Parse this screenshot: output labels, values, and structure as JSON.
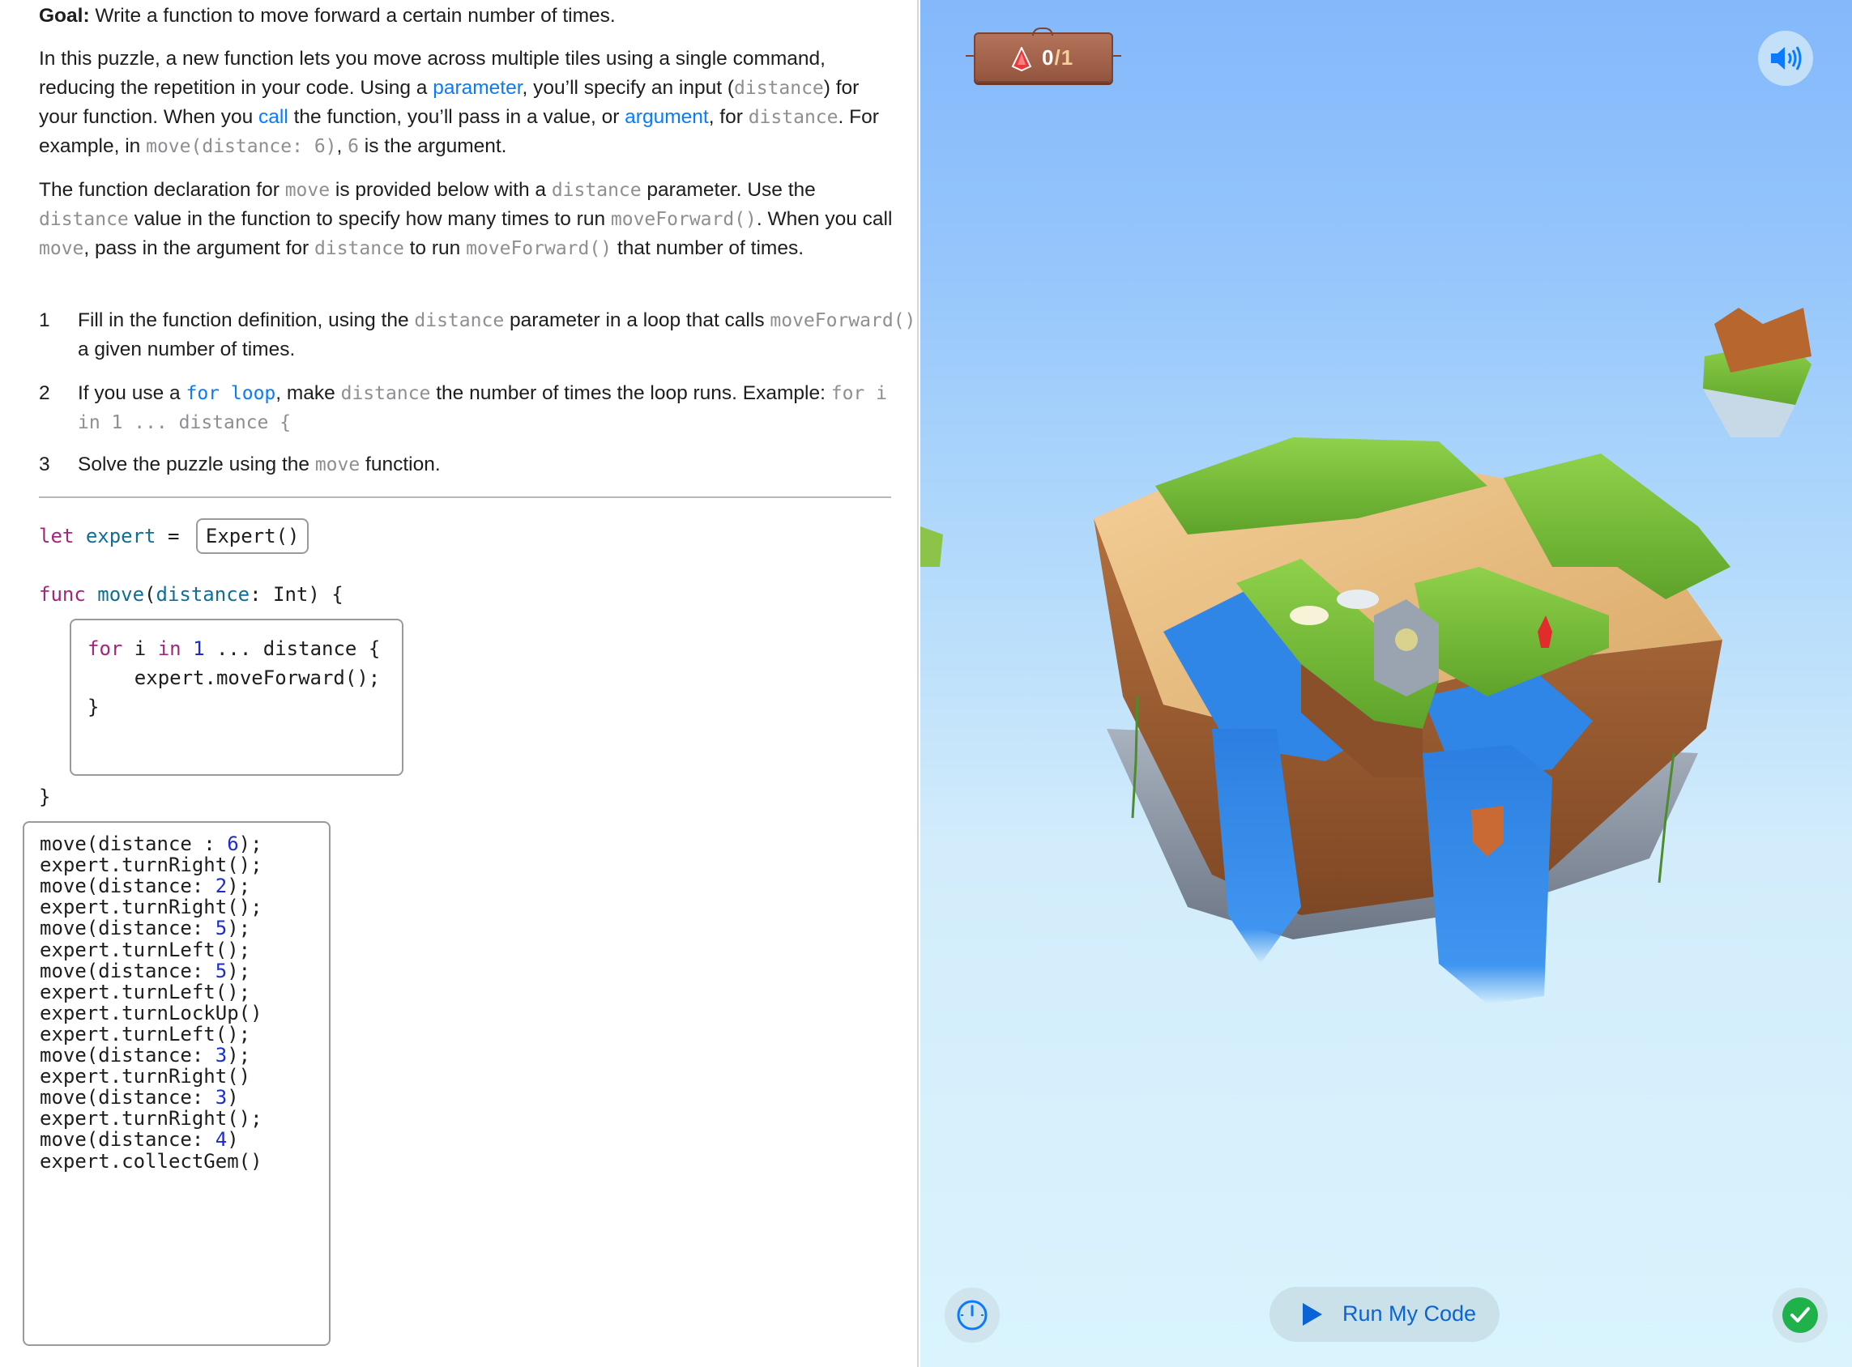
{
  "intro": {
    "goal_label": "Goal:",
    "goal_text": " Write a function to move forward a certain number of times.",
    "p1_a": "In this puzzle, a new function lets you move across multiple tiles using a single command, reducing the repetition in your code. Using a ",
    "p1_link_parameter": "parameter",
    "p1_b": ", you’ll specify an input (",
    "p1_code_distance": "distance",
    "p1_c": ") for your function. When you ",
    "p1_link_call": "call",
    "p1_d": " the function, you’ll pass in a value, or ",
    "p1_link_argument": "argument",
    "p1_e": ", for ",
    "p1_code_distance2": "distance",
    "p1_f": ". For example, in ",
    "p1_code_example": "move(distance: 6)",
    "p1_g": ", ",
    "p1_code_six": "6",
    "p1_h": " is the argument.",
    "p2_a": "The function declaration for ",
    "p2_code_move": "move",
    "p2_b": " is provided below with a ",
    "p2_code_distance": "distance",
    "p2_c": " parameter. Use the ",
    "p2_code_distance2": "distance",
    "p2_d": " value in the function to specify how many times to run ",
    "p2_code_mf": "moveForward()",
    "p2_e": ". When you call ",
    "p2_code_move2": "move",
    "p2_f": ", pass in the argument for ",
    "p2_code_distance3": "distance",
    "p2_g": " to run ",
    "p2_code_mf2": "moveForward()",
    "p2_h": " that number of times."
  },
  "steps": [
    {
      "num": "1",
      "a": "Fill in the function definition, using the ",
      "code1": "distance",
      "b": " parameter in a loop that calls ",
      "code2": "moveForward()",
      "c": " a given number of times."
    },
    {
      "num": "2",
      "a": "If you use a ",
      "link": "for loop",
      "b": ", make ",
      "code1": "distance",
      "c": " the number of times the loop runs. Example: ",
      "code2": "for i in 1 ... distance {"
    },
    {
      "num": "3",
      "a": "Solve the puzzle using the ",
      "code1": "move",
      "b": " function."
    }
  ],
  "code": {
    "let_kw": "let",
    "let_name": "expert",
    "let_eq": " = ",
    "let_value": "Expert()",
    "func_kw": "func",
    "func_name": "move",
    "func_paren": "(",
    "func_param": "distance",
    "func_rest": ": Int) {",
    "body": {
      "for_kw": "for",
      "for_var": " i ",
      "in_kw": "in",
      "one": " 1",
      "range_rest": " ... distance {",
      "line2": "    expert.moveForward();",
      "line3": "}"
    },
    "func_close": "}",
    "main_lines": [
      {
        "pre": "move(distance : ",
        "num": "6",
        "post": ");"
      },
      {
        "pre": "expert.turnRight();",
        "num": "",
        "post": ""
      },
      {
        "pre": "move(distance: ",
        "num": "2",
        "post": ");"
      },
      {
        "pre": "expert.turnRight();",
        "num": "",
        "post": ""
      },
      {
        "pre": "move(distance: ",
        "num": "5",
        "post": ");"
      },
      {
        "pre": "expert.turnLeft();",
        "num": "",
        "post": ""
      },
      {
        "pre": "move(distance: ",
        "num": "5",
        "post": ");"
      },
      {
        "pre": "expert.turnLeft();",
        "num": "",
        "post": ""
      },
      {
        "pre": "expert.turnLockUp()",
        "num": "",
        "post": ""
      },
      {
        "pre": "expert.turnLeft();",
        "num": "",
        "post": ""
      },
      {
        "pre": "move(distance: ",
        "num": "3",
        "post": ");"
      },
      {
        "pre": "expert.turnRight()",
        "num": "",
        "post": ""
      },
      {
        "pre": "move(distance: ",
        "num": "3",
        "post": ")"
      },
      {
        "pre": "expert.turnRight();",
        "num": "",
        "post": ""
      },
      {
        "pre": "move(distance: ",
        "num": "4",
        "post": ")"
      },
      {
        "pre": "expert.collectGem()",
        "num": "",
        "post": ""
      }
    ]
  },
  "game": {
    "gems_collected": "0",
    "gems_separator": "/",
    "gems_total": "1",
    "run_label": "Run My Code",
    "accent": "#0a7aff",
    "sound_icon": "speaker-icon",
    "speed_icon": "speedometer-icon",
    "check_icon": "checkmark-icon"
  }
}
